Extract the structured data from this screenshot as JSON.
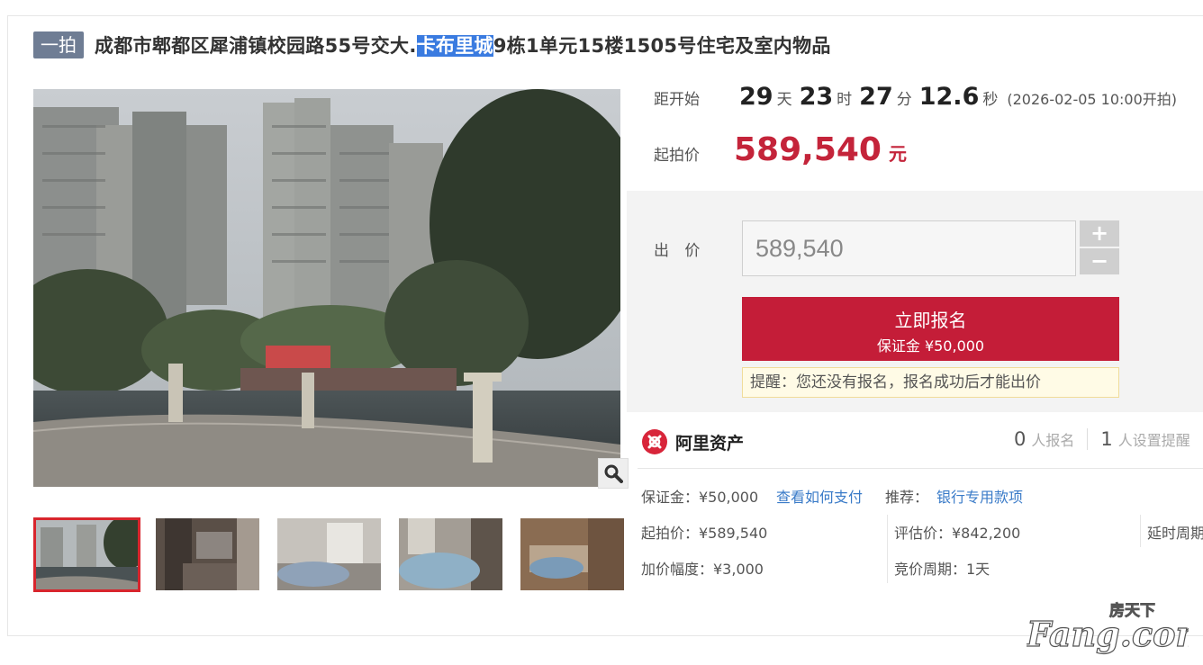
{
  "title": {
    "tag": "一拍",
    "prefix": "成都市郫都区犀浦镇校园路55号交大.",
    "highlight": "卡布里城",
    "suffix": "9栋1单元15楼1505号住宅及室内物品"
  },
  "countdown": {
    "label": "距开始",
    "days": "29",
    "days_unit": "天",
    "hours": "23",
    "hours_unit": "时",
    "minutes": "27",
    "minutes_unit": "分",
    "seconds": "12.6",
    "seconds_unit": "秒",
    "start_note": "(2026-02-05 10:00开拍)"
  },
  "start_price": {
    "label": "起拍价",
    "value": "589,540",
    "unit": "元"
  },
  "bid": {
    "label": "出 价",
    "input_value": "589,540",
    "plus": "+",
    "minus": "−",
    "signup_label": "立即报名",
    "deposit_label": "保证金 ¥50,000",
    "tip": "提醒：您还没有报名，报名成功后才能出价"
  },
  "brand": {
    "name": "阿里资产",
    "icon": "ali-assets-logo-icon"
  },
  "counts": {
    "signups": "0",
    "signups_label": "人报名",
    "reminders": "1",
    "reminders_label": "人设置提醒"
  },
  "details": {
    "deposit": "保证金：¥50,000",
    "how_to_pay": "查看如何支付",
    "recommend_label": "推荐：",
    "recommend_link": "银行专用款项",
    "start_price": "起拍价：¥589,540",
    "appraisal": "评估价：¥842,200",
    "delay": "延时周期",
    "increment": "加价幅度：¥3,000",
    "cycle": "竞价周期：1天"
  },
  "gallery": {
    "zoom_icon": "magnifier-icon",
    "thumbnails": [
      "thumb-1",
      "thumb-2",
      "thumb-3",
      "thumb-4",
      "thumb-5"
    ]
  },
  "watermark": {
    "text_top": "房天下",
    "text_main": "Fang.com"
  },
  "colors": {
    "accent_red": "#c41d38",
    "tag_bg": "#6f7d94",
    "link_blue": "#3a7bc8",
    "highlight": "#3a7be0"
  }
}
